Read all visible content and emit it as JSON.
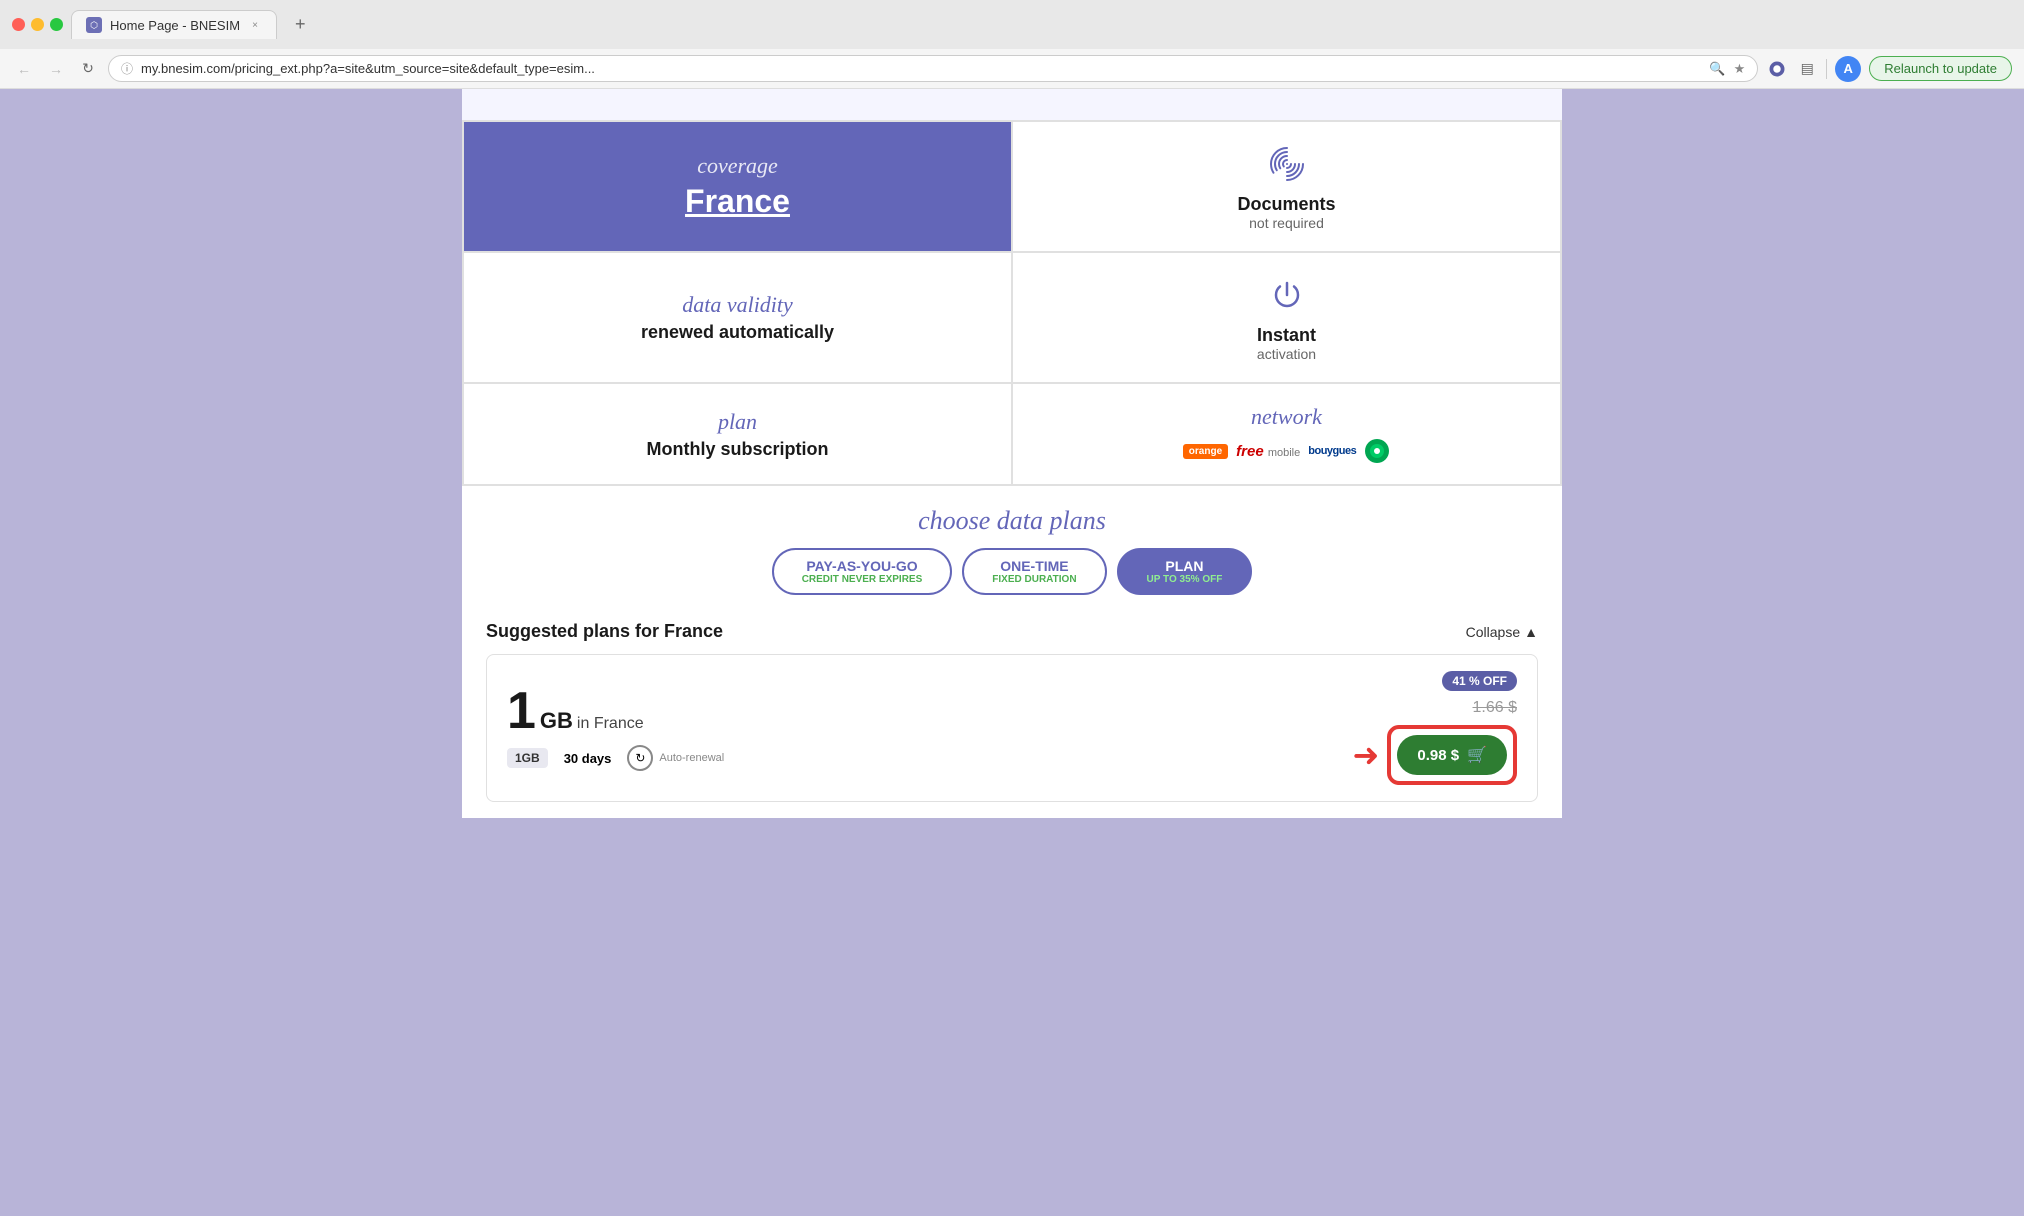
{
  "browser": {
    "tab_title": "Home Page - BNESIM",
    "url": "my.bnesim.com/pricing_ext.php?a=site&utm_source=site&default_type=esim...",
    "relaunch_label": "Relaunch to update",
    "new_tab_symbol": "+",
    "close_tab_symbol": "×"
  },
  "coverage": {
    "label": "coverage",
    "value": "France"
  },
  "documents": {
    "label": "Documents",
    "sub": "not required"
  },
  "data_validity": {
    "label": "data validity",
    "value": "renewed automatically"
  },
  "instant": {
    "label": "Instant",
    "sub": "activation"
  },
  "plan": {
    "label": "plan",
    "value": "Monthly subscription"
  },
  "network": {
    "label": "network"
  },
  "choose_label": "choose data plans",
  "tabs": [
    {
      "id": "pay-as-you-go",
      "label": "PAY-AS-YOU-GO",
      "sub": "CREDIT NEVER EXPIRES",
      "active": false
    },
    {
      "id": "one-time",
      "label": "ONE-TIME",
      "sub": "FIXED DURATION",
      "active": false
    },
    {
      "id": "plan",
      "label": "PLAN",
      "sub": "UP TO 35% OFF",
      "active": true
    }
  ],
  "suggested": {
    "title": "Suggested plans for France",
    "collapse_label": "Collapse",
    "discount_badge": "41 % OFF",
    "plan_gb": "1",
    "plan_gb_label": "GB",
    "plan_country": "in France",
    "plan_size_badge": "1GB",
    "plan_days": "30 days",
    "plan_renewal": "Auto-renewal",
    "original_price": "1.66 $",
    "buy_price": "0.98 $"
  }
}
